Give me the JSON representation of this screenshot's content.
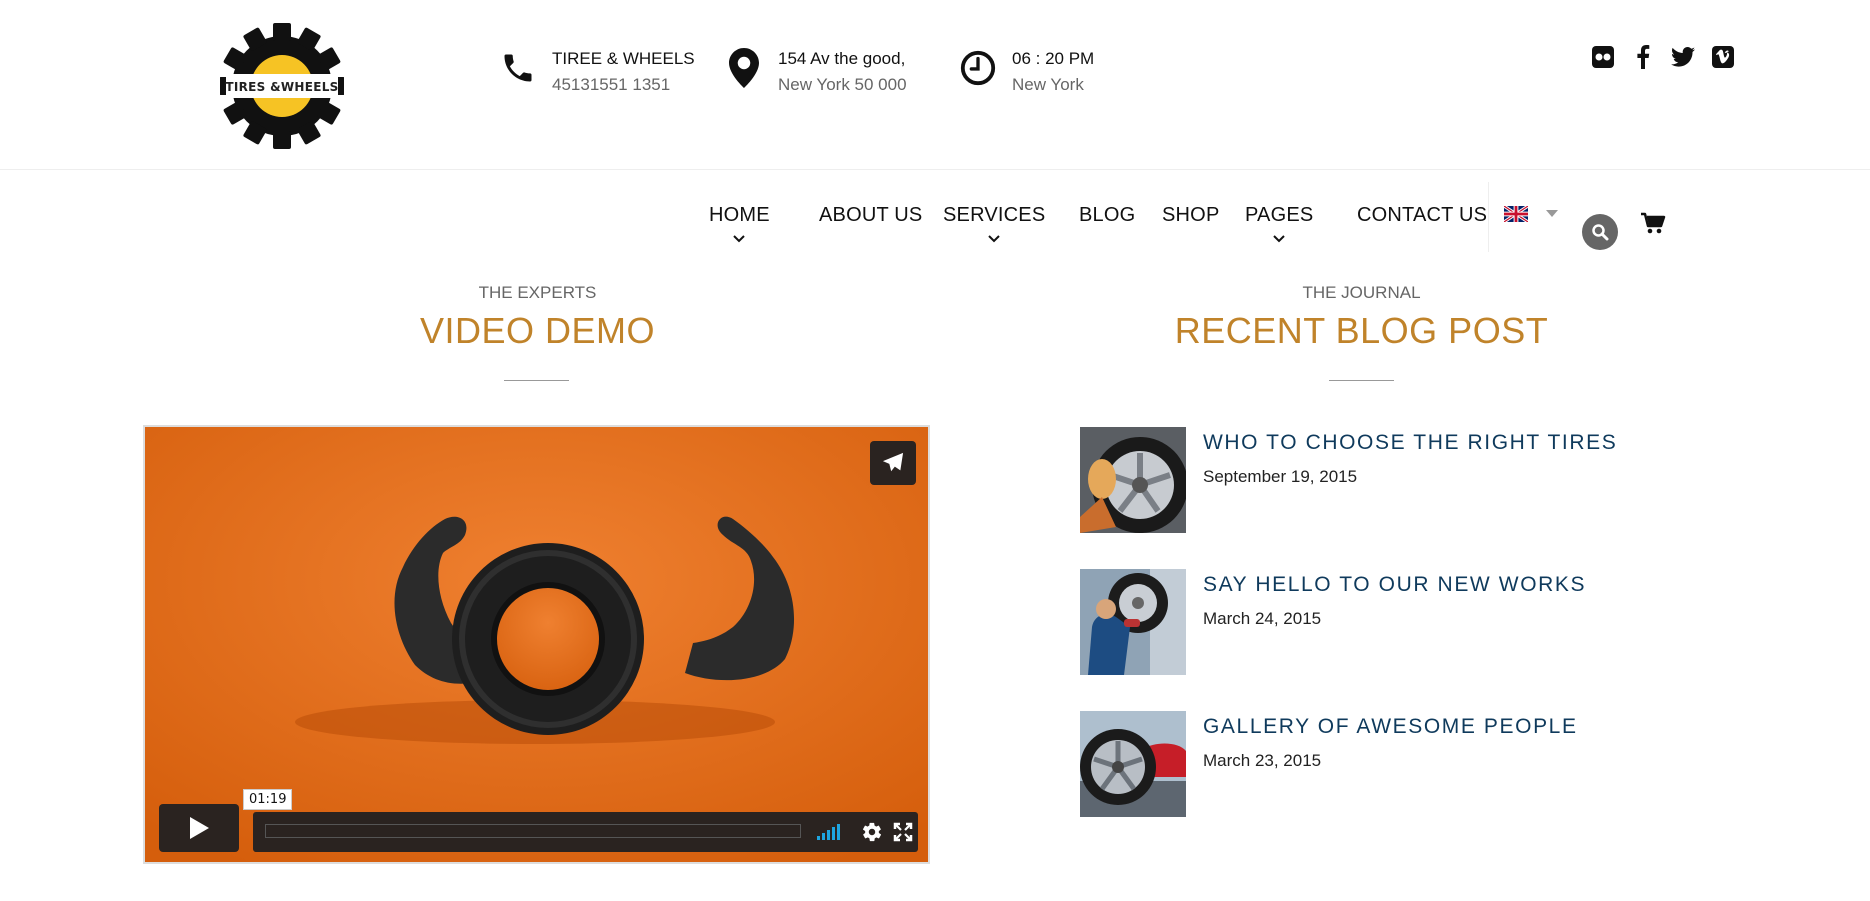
{
  "header": {
    "logo_text": "TIRES &WHEELS",
    "contacts": [
      {
        "icon": "phone-icon",
        "line1": "TIREE & WHEELS",
        "line2": "45131551 1351"
      },
      {
        "icon": "location-pin-icon",
        "line1": "154 Av the good,",
        "line2": "New York 50 000"
      },
      {
        "icon": "clock-icon",
        "line1": "06 : 20 PM",
        "line2": "New York"
      }
    ],
    "social": [
      "flickr-icon",
      "facebook-icon",
      "twitter-icon",
      "vimeo-icon"
    ]
  },
  "nav": {
    "items": [
      {
        "label": "HOME",
        "dropdown": true
      },
      {
        "label": "ABOUT US",
        "dropdown": false
      },
      {
        "label": "SERVICES",
        "dropdown": true
      },
      {
        "label": "BLOG",
        "dropdown": false
      },
      {
        "label": "SHOP",
        "dropdown": false
      },
      {
        "label": "PAGES",
        "dropdown": true
      },
      {
        "label": "CONTACT US",
        "dropdown": false
      }
    ],
    "language_icon": "uk-flag-icon",
    "search_icon": "search-icon",
    "cart_icon": "cart-icon"
  },
  "video_section": {
    "label": "THE EXPERTS",
    "title": "VIDEO DEMO",
    "timecode": "01:19"
  },
  "blog_section": {
    "label": "THE JOURNAL",
    "title": "RECENT BLOG POST",
    "posts": [
      {
        "title": "WHO TO CHOOSE THE RIGHT TIRES",
        "date": "September 19, 2015"
      },
      {
        "title": "SAY HELLO TO OUR NEW WORKS",
        "date": "March 24, 2015"
      },
      {
        "title": "GALLERY OF AWESOME PEOPLE",
        "date": "March 23, 2015"
      }
    ]
  },
  "colors": {
    "accent": "#c0832a",
    "post_title": "#0f3a5c",
    "logo_yellow": "#f6c324",
    "video_bg": "#e26a12"
  }
}
